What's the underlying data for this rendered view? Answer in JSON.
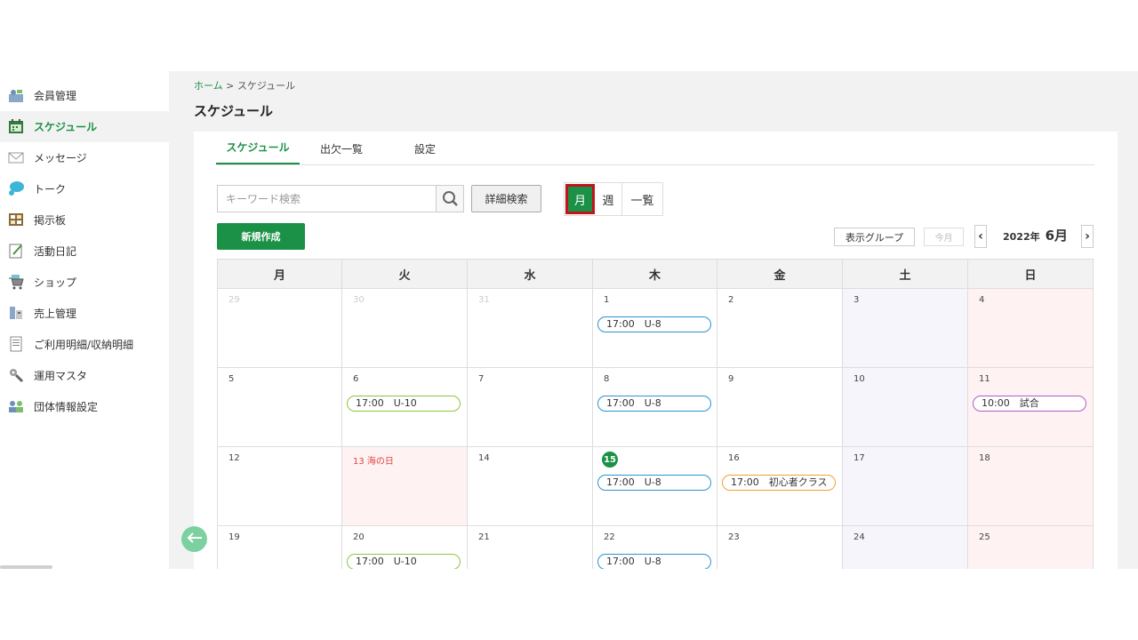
{
  "sidebar": {
    "items": [
      {
        "label": "会員管理",
        "icon": "members-icon"
      },
      {
        "label": "スケジュール",
        "icon": "calendar-icon",
        "active": true
      },
      {
        "label": "メッセージ",
        "icon": "envelope-icon"
      },
      {
        "label": "トーク",
        "icon": "chat-bubble-icon"
      },
      {
        "label": "掲示板",
        "icon": "board-icon"
      },
      {
        "label": "活動日記",
        "icon": "diary-icon"
      },
      {
        "label": "ショップ",
        "icon": "shop-cart-icon"
      },
      {
        "label": "売上管理",
        "icon": "sales-icon"
      },
      {
        "label": "ご利用明細/収納明細",
        "icon": "statement-icon"
      },
      {
        "label": "運用マスタ",
        "icon": "tools-icon"
      },
      {
        "label": "団体情報設定",
        "icon": "group-icon"
      }
    ]
  },
  "breadcrumb": {
    "home": "ホーム",
    "separator": " > ",
    "current": "スケジュール"
  },
  "page_title": "スケジュール",
  "tabs": [
    {
      "label": "スケジュール",
      "active": true
    },
    {
      "label": "出欠一覧"
    },
    {
      "label": "設定"
    }
  ],
  "search": {
    "placeholder": "キーワード検索",
    "value": ""
  },
  "toolbar": {
    "detail_search": "詳細検索",
    "new_button": "新規作成",
    "view_month": "月",
    "view_week": "週",
    "view_list": "一覧",
    "group_button": "表示グループ",
    "today_button": "今月",
    "prev": "‹",
    "next": "›",
    "year_label": "2022年",
    "month_label": "6月"
  },
  "calendar": {
    "weekdays": [
      "月",
      "火",
      "水",
      "木",
      "金",
      "土",
      "日"
    ],
    "weeks": [
      [
        {
          "day": "29",
          "other": true
        },
        {
          "day": "30",
          "other": true
        },
        {
          "day": "31",
          "other": true
        },
        {
          "day": "1",
          "events": [
            {
              "text": "17:00　U-8",
              "color": "blue"
            }
          ]
        },
        {
          "day": "2"
        },
        {
          "day": "3"
        },
        {
          "day": "4"
        }
      ],
      [
        {
          "day": "5"
        },
        {
          "day": "6",
          "events": [
            {
              "text": "17:00　U-10",
              "color": "green"
            }
          ]
        },
        {
          "day": "7"
        },
        {
          "day": "8",
          "events": [
            {
              "text": "17:00　U-8",
              "color": "blue"
            }
          ]
        },
        {
          "day": "9"
        },
        {
          "day": "10"
        },
        {
          "day": "11",
          "events": [
            {
              "text": "10:00　試合",
              "color": "purple"
            }
          ]
        }
      ],
      [
        {
          "day": "12"
        },
        {
          "day": "13 海の日",
          "holiday": true
        },
        {
          "day": "14"
        },
        {
          "day": "15",
          "today": true,
          "events": [
            {
              "text": "17:00　U-8",
              "color": "blue"
            }
          ]
        },
        {
          "day": "16",
          "events": [
            {
              "text": "17:00　初心者クラス",
              "color": "orange"
            }
          ]
        },
        {
          "day": "17"
        },
        {
          "day": "18"
        }
      ],
      [
        {
          "day": "19"
        },
        {
          "day": "20",
          "events": [
            {
              "text": "17:00　U-10",
              "color": "green"
            }
          ]
        },
        {
          "day": "21"
        },
        {
          "day": "22",
          "events": [
            {
              "text": "17:00　U-8",
              "color": "blue"
            }
          ]
        },
        {
          "day": "23"
        },
        {
          "day": "24"
        },
        {
          "day": "25"
        }
      ]
    ]
  },
  "colors": {
    "accent": "#1a9146",
    "highlight_border": "#c0151b",
    "event_blue": "#2b94d0",
    "event_green": "#8cc63f",
    "event_orange": "#f0a030",
    "event_purple": "#b35cc8"
  }
}
